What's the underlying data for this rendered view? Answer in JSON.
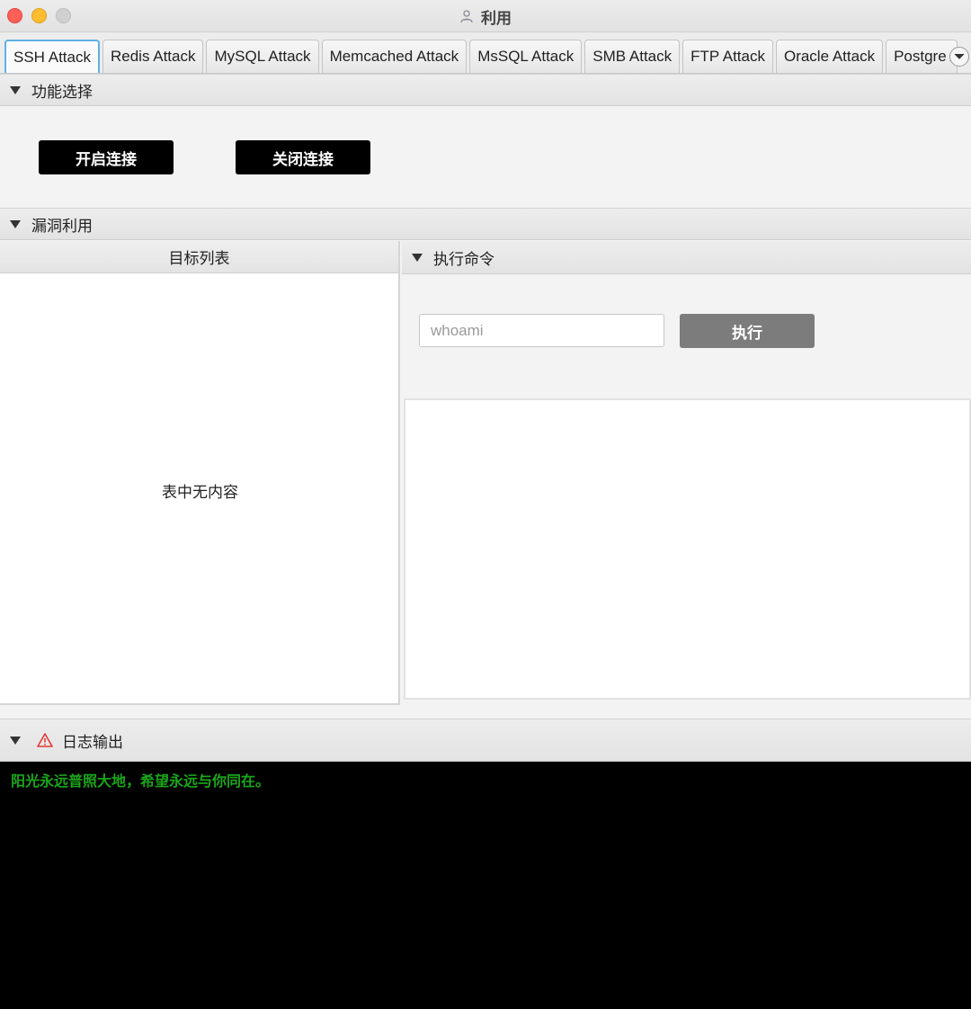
{
  "window": {
    "title": "利用"
  },
  "tabs": [
    {
      "label": "SSH Attack",
      "active": true
    },
    {
      "label": "Redis Attack"
    },
    {
      "label": "MySQL Attack"
    },
    {
      "label": "Memcached Attack"
    },
    {
      "label": "MsSQL Attack"
    },
    {
      "label": "SMB Attack"
    },
    {
      "label": "FTP Attack"
    },
    {
      "label": "Oracle Attack"
    },
    {
      "label": "Postgre Attack"
    }
  ],
  "function_section": {
    "title": "功能选择",
    "open_label": "开启连接",
    "close_label": "关闭连接"
  },
  "exploit_section": {
    "title": "漏洞利用"
  },
  "target_list": {
    "header": "目标列表",
    "empty_text": "表中无内容"
  },
  "exec_panel": {
    "title": "执行命令",
    "input_placeholder": "whoami",
    "exec_label": "执行"
  },
  "log": {
    "title": "日志输出",
    "message": "阳光永远普照大地，希望永远与你同在。"
  },
  "colors": {
    "log_text": "#19a619",
    "active_tab_border": "#5fb0e6",
    "warning": "#e53935"
  },
  "icons": [
    "person-icon",
    "chevron-down-icon",
    "collapse-arrow-icon",
    "warning-icon"
  ]
}
